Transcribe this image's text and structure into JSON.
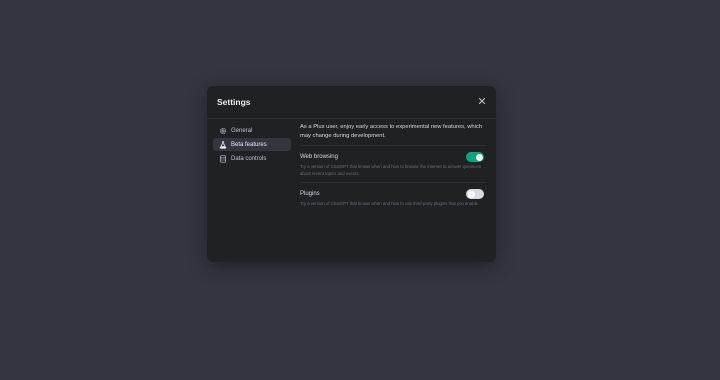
{
  "dialog": {
    "title": "Settings",
    "close_icon": "close-icon"
  },
  "sidebar": {
    "items": [
      {
        "label": "General",
        "icon": "gear-icon",
        "active": false
      },
      {
        "label": "Beta features",
        "icon": "flask-icon",
        "active": true
      },
      {
        "label": "Data controls",
        "icon": "database-icon",
        "active": false
      }
    ]
  },
  "beta": {
    "intro": "As a Plus user, enjoy early access to experimental new features, which may change during development.",
    "features": [
      {
        "name": "Web browsing",
        "description": "Try a version of ChatGPT that knows when and how to browse the internet to answer questions about recent topics and events.",
        "enabled": true
      },
      {
        "name": "Plugins",
        "description": "Try a version of ChatGPT that knows when and how to use third-party plugins that you enable.",
        "enabled": false
      }
    ]
  },
  "colors": {
    "background": "#343541",
    "dialog": "#202123",
    "toggle_on": "#10a37f",
    "toggle_off": "#d9d9e3"
  }
}
